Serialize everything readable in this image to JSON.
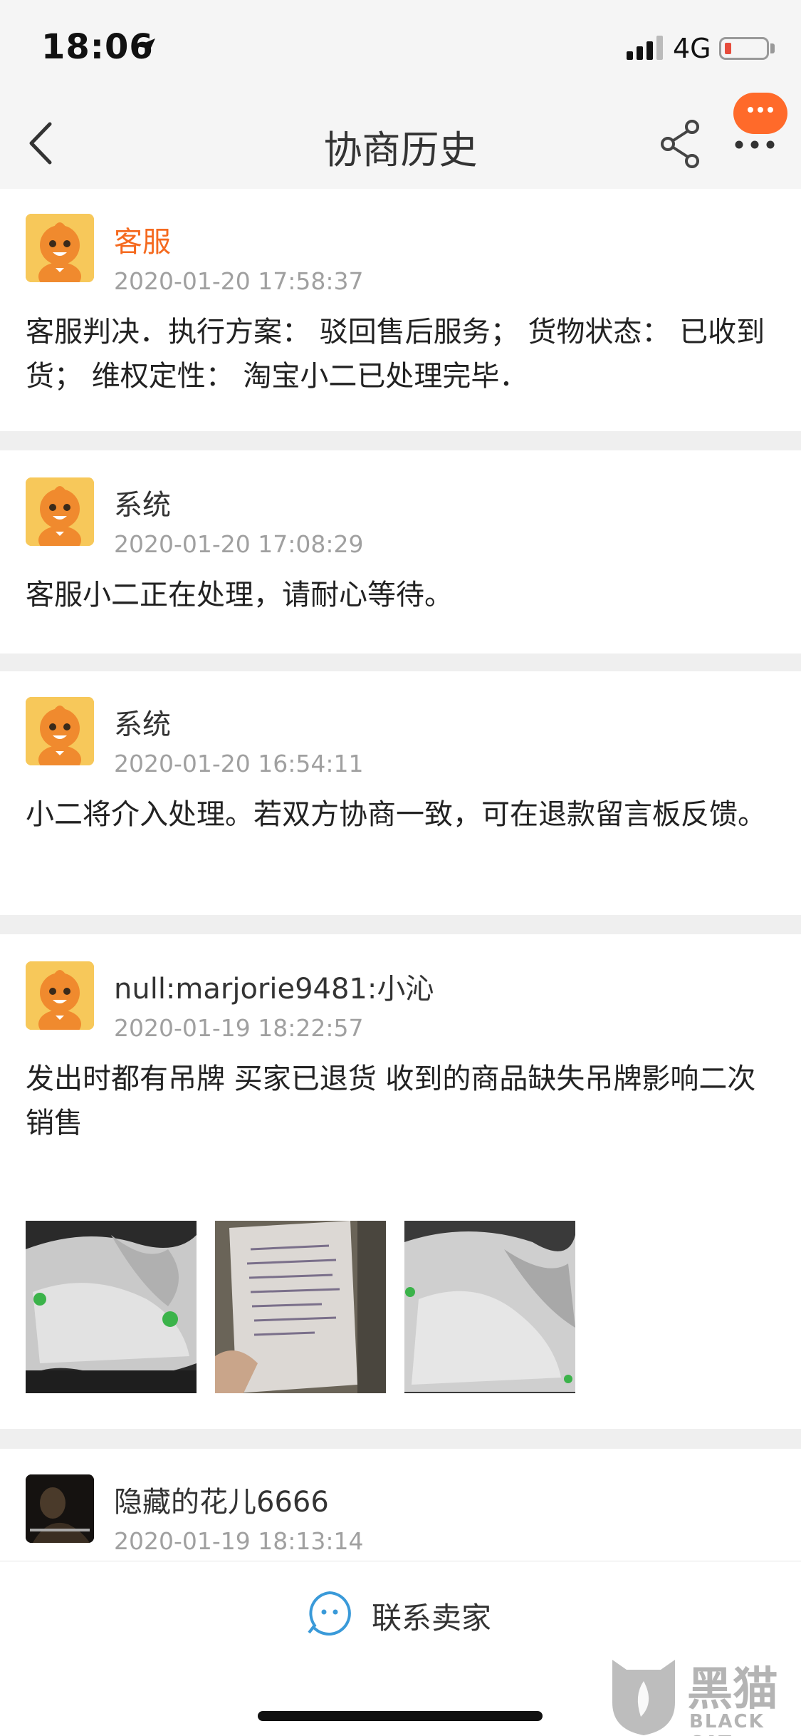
{
  "status_bar": {
    "time": "18:06",
    "network": "4G"
  },
  "nav": {
    "title": "协商历史"
  },
  "records": [
    {
      "sender": "客服",
      "timestamp": "2020-01-20 17:58:37",
      "message": "客服判决．执行方案：  驳回售后服务；  货物状态：  已收到货；  维权定性：  淘宝小二已处理完毕．"
    },
    {
      "sender": "系统",
      "timestamp": "2020-01-20 17:08:29",
      "message": "客服小二正在处理，请耐心等待。"
    },
    {
      "sender": "系统",
      "timestamp": "2020-01-20 16:54:11",
      "message": "小二将介入处理。若双方协商一致，可在退款留言板反馈。"
    },
    {
      "sender": "null:marjorie9481:小沁",
      "timestamp": "2020-01-19 18:22:57",
      "message": "发出时都有吊牌  买家已退货  收到的商品缺失吊牌影响二次销售"
    },
    {
      "sender": "隐藏的花儿6666",
      "timestamp": "2020-01-19 18:13:14"
    }
  ],
  "bottom": {
    "contact_label": "联系卖家"
  },
  "watermark": {
    "main": "黑猫",
    "sub": "BLACK CAT"
  },
  "icons": {
    "back": "chevron-left-icon",
    "share": "share-icon",
    "more": "more-icon",
    "contact": "chat-bubble-icon"
  },
  "colors": {
    "accent": "#f56a1f",
    "timestamp": "#a0a0a0",
    "background": "#efefef"
  }
}
